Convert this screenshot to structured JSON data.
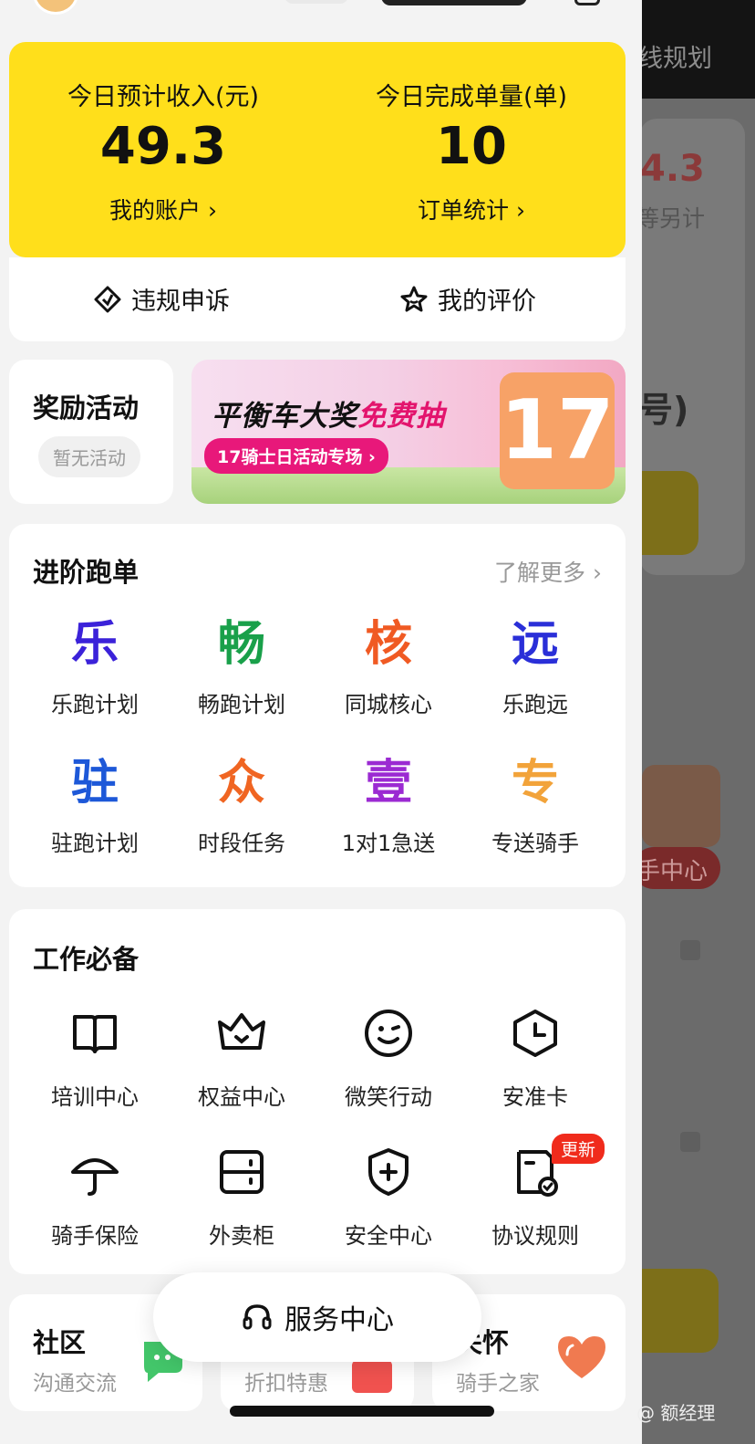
{
  "background_app": {
    "top_text": "线规划",
    "number": "4.3",
    "sub_text": "等另计",
    "bracket_text": "号)",
    "pill_text": "手中心"
  },
  "stats": {
    "income_label": "今日预计收入(元)",
    "income_value": "49.3",
    "income_link": "我的账户 ›",
    "orders_label": "今日完成单量(单)",
    "orders_value": "10",
    "orders_link": "订单统计 ›"
  },
  "quick_actions": {
    "appeal": "违规申诉",
    "rating": "我的评价"
  },
  "reward": {
    "title": "奖励活动",
    "status": "暂无活动"
  },
  "banner": {
    "title_a": "平衡车大奖",
    "title_b": "免费抽",
    "subtitle": "17骑士日活动专场 ›",
    "badge": "17"
  },
  "advanced": {
    "title": "进阶跑单",
    "more": "了解更多 ›",
    "items": [
      {
        "glyph": "乐",
        "label": "乐跑计划",
        "color": "#3b22d9"
      },
      {
        "glyph": "畅",
        "label": "畅跑计划",
        "color": "#19a04a"
      },
      {
        "glyph": "核",
        "label": "同城核心",
        "color": "#f05a23"
      },
      {
        "glyph": "远",
        "label": "乐跑远",
        "color": "#2a2fd8"
      },
      {
        "glyph": "驻",
        "label": "驻跑计划",
        "color": "#1d58d8"
      },
      {
        "glyph": "众",
        "label": "时段任务",
        "color": "#f06522"
      },
      {
        "glyph": "壹",
        "label": "1对1急送",
        "color": "#9b2ad2"
      },
      {
        "glyph": "专",
        "label": "专送骑手",
        "color": "#f2a33a"
      }
    ]
  },
  "essentials": {
    "title": "工作必备",
    "items": [
      {
        "icon": "book-icon",
        "label": "培训中心"
      },
      {
        "icon": "crown-icon",
        "label": "权益中心"
      },
      {
        "icon": "smile-icon",
        "label": "微笑行动"
      },
      {
        "icon": "clock-icon",
        "label": "安准卡"
      },
      {
        "icon": "umbrella-icon",
        "label": "骑手保险"
      },
      {
        "icon": "locker-icon",
        "label": "外卖柜"
      },
      {
        "icon": "shield-plus-icon",
        "label": "安全中心"
      },
      {
        "icon": "document-check-icon",
        "label": "协议规则",
        "badge": "更新"
      }
    ]
  },
  "bottom_cards": [
    {
      "title": "社区",
      "sub": "沟通交流"
    },
    {
      "title": "",
      "sub": "折扣特惠"
    },
    {
      "title": "关怀",
      "sub": "骑手之家"
    }
  ],
  "service_center": "服务中心",
  "watermark": "@ 额经理"
}
